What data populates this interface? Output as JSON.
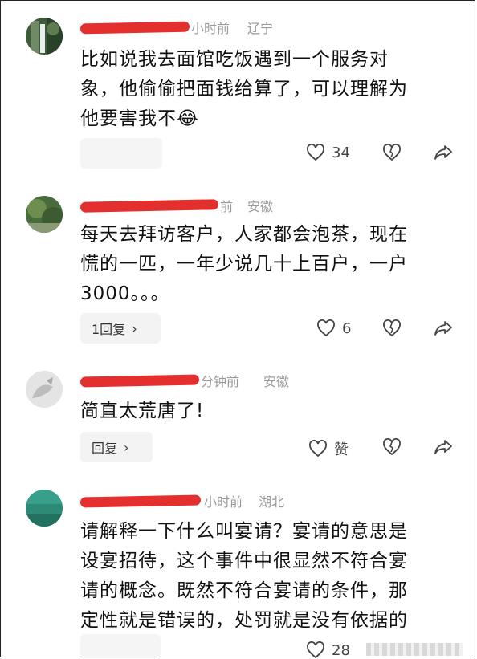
{
  "comments": [
    {
      "time": "小时前",
      "location": "辽宁",
      "text": [
        "比如说我去面馆吃饭遇到一个服务对",
        "象，他偷偷把面钱给算了，可以理解为",
        "他要害我不"
      ],
      "emoji": "😂",
      "reply_label": "",
      "like_count": "34"
    },
    {
      "time": "前",
      "location": "安徽",
      "text": [
        "每天去拜访客户，人家都会泡茶，现在",
        "慌的一匹，一年少说几十上百户，一户",
        "3000。。。"
      ],
      "reply_label": "1回复",
      "like_count": "6"
    },
    {
      "time": "分钟前",
      "location": "安徽",
      "text": [
        "简直太荒唐了!"
      ],
      "reply_label": "回复",
      "like_count": "赞"
    },
    {
      "time": "小时前",
      "location": "湖北",
      "text": [
        "请解释一下什么叫宴请？宴请的意思是",
        "设宴招待，这个事件中很显然不符合宴",
        "请的概念。既然不符合宴请的条件，那",
        "定性就是错误的，处罚就是没有依据的"
      ],
      "reply_label": "",
      "like_count": "28"
    }
  ],
  "colors": {
    "redaction": "#e32424",
    "meta_gray": "#9a9a9a"
  },
  "icons": [
    "heart-outline-icon",
    "broken-heart-icon",
    "share-arrow-icon",
    "chevron-right-icon"
  ]
}
